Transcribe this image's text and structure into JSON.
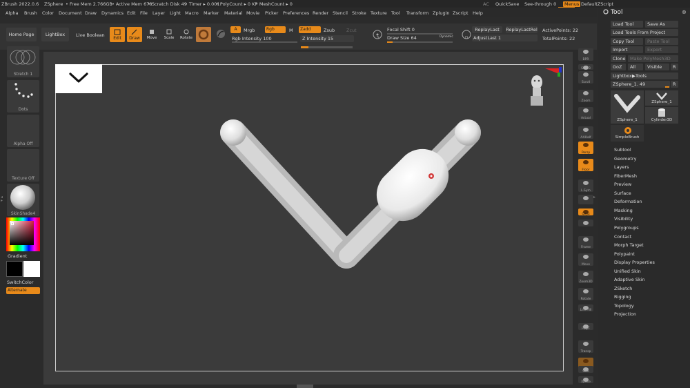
{
  "titlebar": {
    "app": "ZBrush 2022.0.6",
    "tool": "ZSphere",
    "free_mem": "• Free Mem 2.766GB",
    "active_mem": "• Active Mem 678",
    "scratch": "• Scratch Disk 49",
    "timer": "• Timer ▸ 0.001",
    "polycount": "• PolyCount ▸ 0 KP",
    "meshcount": "• MeshCount ▸ 0",
    "ac": "AC",
    "quicksave": "QuickSave",
    "seethrough": "See-through  0",
    "menus": "Menus",
    "default_script": "DefaultZScript"
  },
  "menus": [
    "Alpha",
    "Brush",
    "Color",
    "Document",
    "Draw",
    "Dynamics",
    "Edit",
    "File",
    "Layer",
    "Light",
    "Macro",
    "Marker",
    "Material",
    "Movie",
    "Picker",
    "Preferences",
    "Render",
    "Stencil",
    "Stroke",
    "Texture",
    "Tool",
    "Transform",
    "Zplugin",
    "Zscript",
    "Help"
  ],
  "toolbar": {
    "home": "Home Page",
    "lightbox": "LightBox",
    "live_boolean": "Live Boolean",
    "edit": "Edit",
    "draw": "Draw",
    "move": "Move",
    "scale": "Scale",
    "rotate": "Rotate",
    "a": "A",
    "mrgb": "Mrgb",
    "rgb": "Rgb",
    "m": "M",
    "rgb_intensity": "Rgb Intensity 100",
    "zadd": "Zadd",
    "zsub": "Zsub",
    "zcut": "Zcut",
    "z_intensity": "Z Intensity 15",
    "z_intensity_value": 0.15,
    "s": "S",
    "focal_shift": "Focal Shift 0",
    "draw_size": "Draw Size 64",
    "dynamic": "Dynamic",
    "d": "D",
    "replay_last": "ReplayLast",
    "replay_last_rel": "ReplayLastRel",
    "adjust_last": "AdjustLast 1",
    "active_points": "ActivePoints: 22",
    "total_points": "TotalPoints: 22"
  },
  "left_shelf": {
    "stroke": "Stretch 1",
    "alpha_dots": "Dots",
    "alpha": "Alpha Off",
    "texture": "Texture Off",
    "material": "SkinShade4",
    "gradient": "Gradient",
    "switch_color": "SwitchColor",
    "alternate": "Alternate"
  },
  "right_tools": [
    {
      "name": "bpr",
      "label": "BPR"
    },
    {
      "name": "spix",
      "label": "SPix 3"
    },
    {
      "name": "scroll",
      "label": "Scroll"
    },
    {
      "name": "zoom",
      "label": "Zoom"
    },
    {
      "name": "actual",
      "label": "Actual"
    },
    {
      "name": "aahalf",
      "label": "AAHalf"
    },
    {
      "name": "persp",
      "label": "Persp"
    },
    {
      "name": "floor",
      "label": "Floor"
    },
    {
      "name": "lsym",
      "label": "L.Sym"
    },
    {
      "name": "lock",
      "label": ""
    },
    {
      "name": "qxyz",
      "label": "Qxyz"
    },
    {
      "name": "rot",
      "label": ""
    },
    {
      "name": "frame",
      "label": "Frame"
    },
    {
      "name": "move",
      "label": "Move"
    },
    {
      "name": "zoom3d",
      "label": "Zoom3D"
    },
    {
      "name": "rotate",
      "label": "Rotate"
    },
    {
      "name": "linefill",
      "label": "Line Fill"
    },
    {
      "name": "polyf",
      "label": "PolyF"
    },
    {
      "name": "transp",
      "label": "Transp"
    },
    {
      "name": "ghost",
      "label": "Ghost"
    },
    {
      "name": "solo",
      "label": "Solo"
    },
    {
      "name": "xpose",
      "label": "Xpose"
    }
  ],
  "tool_panel": {
    "title": "Tool",
    "load_tool": "Load Tool",
    "save_as": "Save As",
    "load_from_project": "Load Tools From Project",
    "copy_tool": "Copy Tool",
    "paste_tool": "Paste Tool",
    "import": "Import",
    "export": "Export",
    "clone": "Clone",
    "make_polymesh": "Make PolyMesh3D",
    "goz": "GoZ",
    "all": "All",
    "visible": "Visible",
    "r": "R",
    "lightbox_tools": "Lightbox▶Tools",
    "zsphere_slider": "ZSphere_1. 49",
    "thumbs": [
      "ZSphere_1",
      "ZSphere_1",
      "Cylinder3D",
      "SimpleBrush"
    ],
    "sections": [
      "Subtool",
      "Geometry",
      "Layers",
      "FiberMesh",
      "Preview",
      "Surface",
      "Deformation",
      "Masking",
      "Visibility",
      "Polygroups",
      "Contact",
      "Morph Target",
      "Polypaint",
      "Display Properties",
      "Unified Skin",
      "Adaptive Skin",
      "ZSketch",
      "Rigging",
      "Topology",
      "Projection"
    ]
  },
  "colors": {
    "accent": "#e88a1a",
    "bg": "#2b2b2b",
    "canvas": "#3b3b3b"
  }
}
